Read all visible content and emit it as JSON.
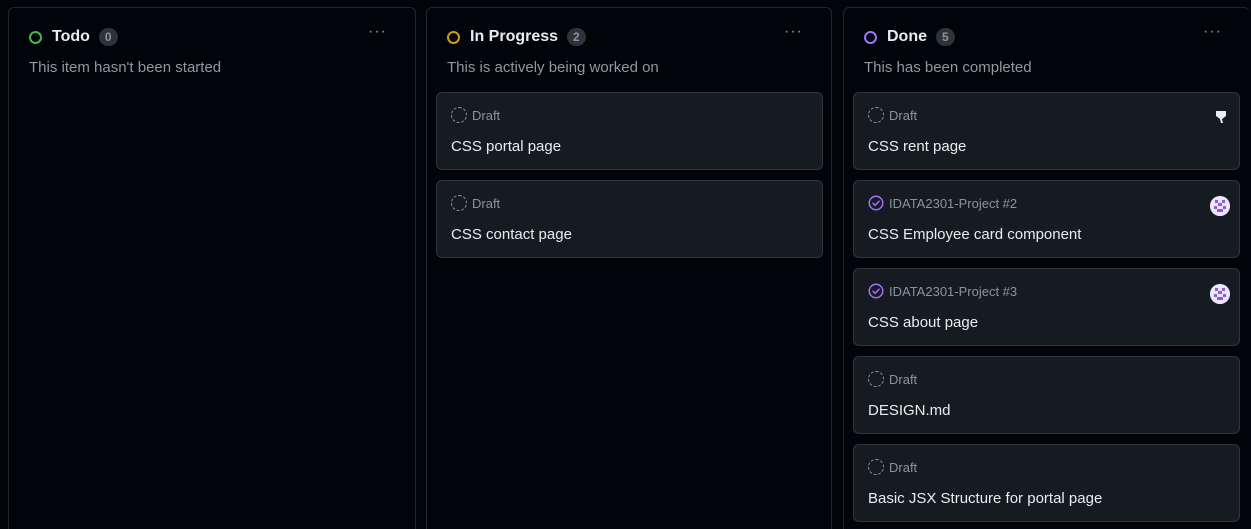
{
  "columns": [
    {
      "title": "Todo",
      "count": "0",
      "status_color": "#3fb950",
      "description": "This item hasn't been started",
      "menu": "···",
      "cards": []
    },
    {
      "title": "In Progress",
      "count": "2",
      "status_color": "#d29922",
      "description": "This is actively being worked on",
      "menu": "···",
      "cards": [
        {
          "meta": "Draft",
          "title": "CSS portal page",
          "type": "draft-icon"
        },
        {
          "meta": "Draft",
          "title": "CSS contact page",
          "type": "draft-icon"
        }
      ]
    },
    {
      "title": "Done",
      "count": "5",
      "status_color": "#a371f7",
      "description": "This has been completed",
      "menu": "···",
      "cards": [
        {
          "meta": "Draft",
          "title": "CSS rent page",
          "type": "draft-icon",
          "right": "shield-icon"
        },
        {
          "meta": "IDATA2301-Project #2",
          "title": "CSS Employee card component",
          "type": "issue-closed-icon",
          "right": "avatar"
        },
        {
          "meta": "IDATA2301-Project #3",
          "title": "CSS about page",
          "type": "issue-closed-icon",
          "right": "avatar"
        },
        {
          "meta": "Draft",
          "title": "DESIGN.md",
          "type": "draft-icon"
        },
        {
          "meta": "Draft",
          "title": "Basic JSX Structure for portal page",
          "type": "draft-icon"
        }
      ]
    }
  ]
}
